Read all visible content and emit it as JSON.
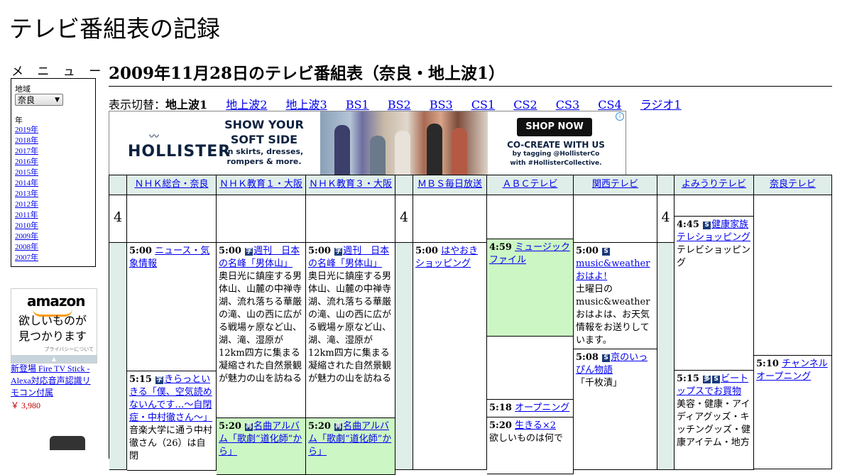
{
  "site_title": "テレビ番組表の記録",
  "sidebar": {
    "menu_label": "メ ニ ュ ー",
    "region_label": "地域",
    "region_selected": "奈良",
    "year_label": "年",
    "years": [
      "2019年",
      "2018年",
      "2017年",
      "2016年",
      "2015年",
      "2014年",
      "2013年",
      "2012年",
      "2011年",
      "2010年",
      "2009年",
      "2008年",
      "2007年"
    ],
    "ad": {
      "logo": "amazon",
      "copy_line1": "欲しいものが",
      "copy_line2": "見つかります",
      "privacy": "プライバシーについて",
      "product_title": "新登場 Fire TV Stick - Alexa対応音声認識リモコン付属",
      "product_price": "￥ 3,980"
    }
  },
  "main": {
    "page_title": "2009年11月28日のテレビ番組表（奈良・地上波1）",
    "switch_label": "表示切替：",
    "switch_current": "地上波1",
    "switch_links": [
      "地上波2",
      "地上波3",
      "BS1",
      "BS2",
      "BS3",
      "CS1",
      "CS2",
      "CS3",
      "CS4",
      "ラジオ1"
    ],
    "banner": {
      "brand": "HOLLISTER",
      "tagline": "SHOW YOUR SOFT SIDE",
      "sub": "in skirts, dresses, rompers & more.",
      "cta": "SHOP NOW",
      "cocreate": "CO-CREATE WITH US",
      "cocreate_sub": "by tagging @HollisterCo with #HollisterCollective."
    }
  },
  "schedule": {
    "hour": "4",
    "channels": [
      "ＮＨＫ総合・奈良",
      "ＮＨＫ教育１・大阪",
      "ＮＨＫ教育３・大阪",
      "ＭＢＳ毎日放送",
      "ＡＢＣテレビ",
      "関西テレビ",
      "よみうりテレビ",
      "奈良テレビ"
    ],
    "programs": {
      "nhk_g_1": {
        "time": "5:00",
        "title": "ニュース・気象情報"
      },
      "nhk_g_2": {
        "time": "5:15",
        "title": "きらっといきる「僕、空気読めないんです…～自閉症・中村徹さん～」",
        "desc": "音楽大学に通う中村徹さん（26）は自閉"
      },
      "nhk_e1_1": {
        "time": "5:00",
        "title": "週刊　日本の名峰「男体山」",
        "desc": "奥日光に鎮座する男体山、山麓の中禅寺湖、流れ落ちる華厳の滝、山の西に広がる戦場ヶ原など山、湖、滝、湿原が12km四方に集まる凝縮された自然景観が魅力の山を訪ねる"
      },
      "nhk_e1_2": {
        "time": "5:20",
        "title": "名曲アルバム「歌劇“道化師”から」"
      },
      "nhk_e3_1": {
        "time": "5:00",
        "title": "週刊　日本の名峰「男体山」",
        "desc": "奥日光に鎮座する男体山、山麓の中禅寺湖、流れ落ちる華厳の滝、山の西に広がる戦場ヶ原など山、湖、滝、湿原が12km四方に集まる凝縮された自然景観が魅力の山を訪ねる"
      },
      "nhk_e3_2": {
        "time": "5:20",
        "title": "名曲アルバム「歌劇“道化師”から」"
      },
      "mbs_1": {
        "time": "5:00",
        "title": "はやおきショッピング"
      },
      "abc_1": {
        "time": "4:59",
        "title": "ミュージックファイル"
      },
      "abc_2": {
        "time": "5:18",
        "title": "オープニング"
      },
      "abc_3": {
        "time": "5:20",
        "title": "生きる×2",
        "desc": "欲しいものは何で"
      },
      "ktv_1": {
        "time": "5:00",
        "title": "music&weatherおはよ!",
        "desc": "土曜日のmusic&weatherおはよは、お天気情報をお送りしています。"
      },
      "ktv_2": {
        "time": "5:08",
        "title": "京のいっぴん物語",
        "desc": "「千枚漬」"
      },
      "ytv_1": {
        "time": "4:45",
        "title": "健康家族テレショッピング",
        "desc": "テレビショッピング"
      },
      "ytv_2": {
        "time": "5:15",
        "title": "ビートップスでお買物",
        "desc": "美容・健康・アイディアグッズ・キッチングッズ・健康アイテム・地方"
      },
      "nara_1": {
        "time": "5:10",
        "title": "チャンネルオープニング"
      }
    }
  }
}
